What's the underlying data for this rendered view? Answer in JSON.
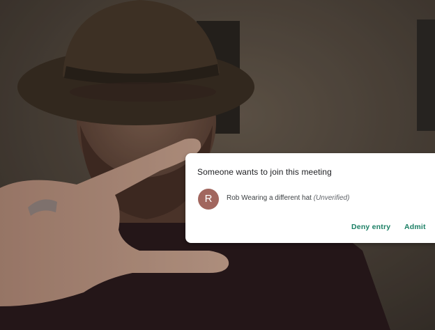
{
  "dialog": {
    "title": "Someone wants to join this meeting",
    "guest": {
      "avatar_letter": "R",
      "avatar_color": "#a1665e",
      "name": "Rob Wearing a different hat",
      "status": "(Unverified)"
    },
    "actions": {
      "deny_label": "Deny entry",
      "admit_label": "Admit",
      "accent_color": "#1a7f64"
    }
  }
}
